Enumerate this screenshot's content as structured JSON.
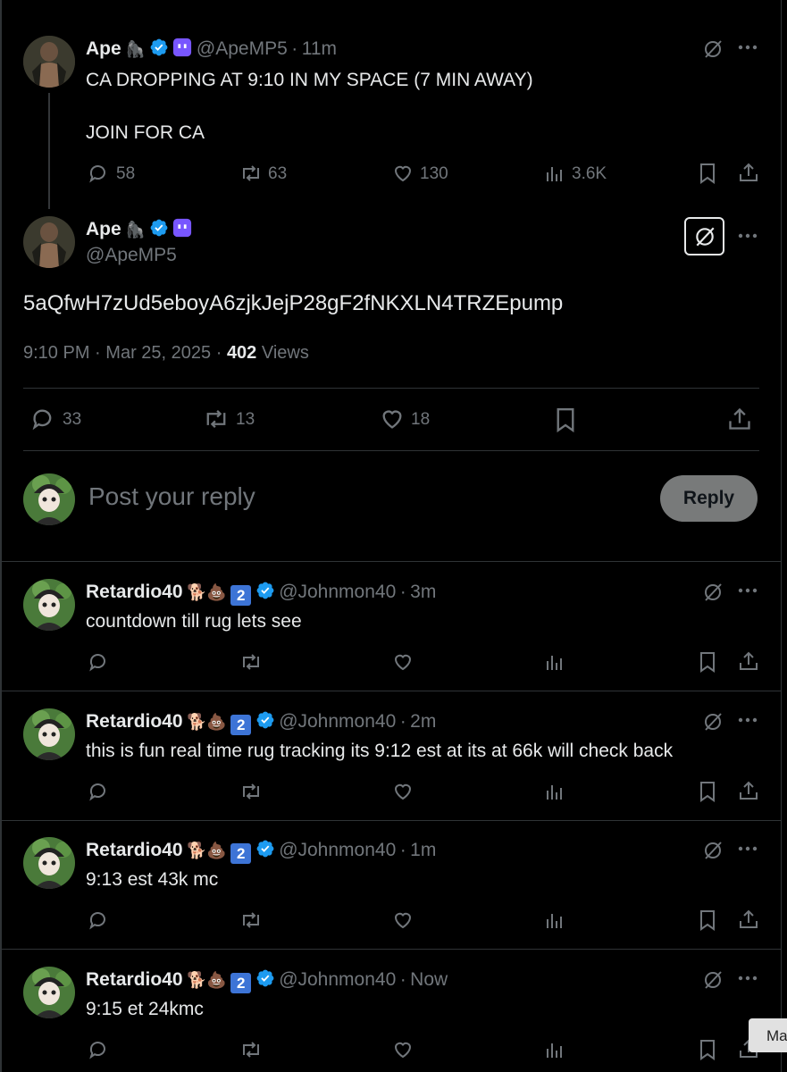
{
  "main_tweet": {
    "display_name": "Ape",
    "emoji_badges": "🦍",
    "handle": "@ApeMP5",
    "separator": "·",
    "time_ago": "11m",
    "text_line1": "CA DROPPING AT 9:10 IN MY SPACE (7 MIN AWAY)",
    "text_line2": "JOIN FOR CA",
    "replies": "58",
    "reposts": "63",
    "likes": "130",
    "views": "3.6K"
  },
  "focused_tweet": {
    "display_name": "Ape",
    "emoji_badges": "🦍",
    "handle": "@ApeMP5",
    "text": "5aQfwH7zUd5eboyA6zjkJejP28gF2fNKXLN4TRZEpump",
    "time": "9:10 PM",
    "separator": "·",
    "date": "Mar 25, 2025",
    "views_count": "402",
    "views_label": "Views",
    "replies": "33",
    "reposts": "13",
    "likes": "18"
  },
  "composer": {
    "placeholder": "Post your reply",
    "button_label": "Reply"
  },
  "replies": [
    {
      "display_name": "Retardio40",
      "emoji_badges": "🐕💩",
      "number_badge": "2",
      "handle": "@Johnmon40",
      "separator": "·",
      "time_ago": "3m",
      "text": "countdown till rug lets see"
    },
    {
      "display_name": "Retardio40",
      "emoji_badges": "🐕💩",
      "number_badge": "2",
      "handle": "@Johnmon40",
      "separator": "·",
      "time_ago": "2m",
      "text": "this is fun real time rug tracking its 9:12 est at its at 66k will check back"
    },
    {
      "display_name": "Retardio40",
      "emoji_badges": "🐕💩",
      "number_badge": "2",
      "handle": "@Johnmon40",
      "separator": "·",
      "time_ago": "1m",
      "text": "9:13 est 43k mc"
    },
    {
      "display_name": "Retardio40",
      "emoji_badges": "🐕💩",
      "number_badge": "2",
      "handle": "@Johnmon40",
      "separator": "·",
      "time_ago": "Now",
      "text": "9:15 et 24kmc"
    }
  ],
  "toast": {
    "text": "Ma"
  },
  "colors": {
    "background": "#000000",
    "text": "#e7e9ea",
    "secondary": "#71767b",
    "verified": "#1d9bf0",
    "subscriber_badge": "#7856ff",
    "number_badge": "#3d74d6"
  }
}
